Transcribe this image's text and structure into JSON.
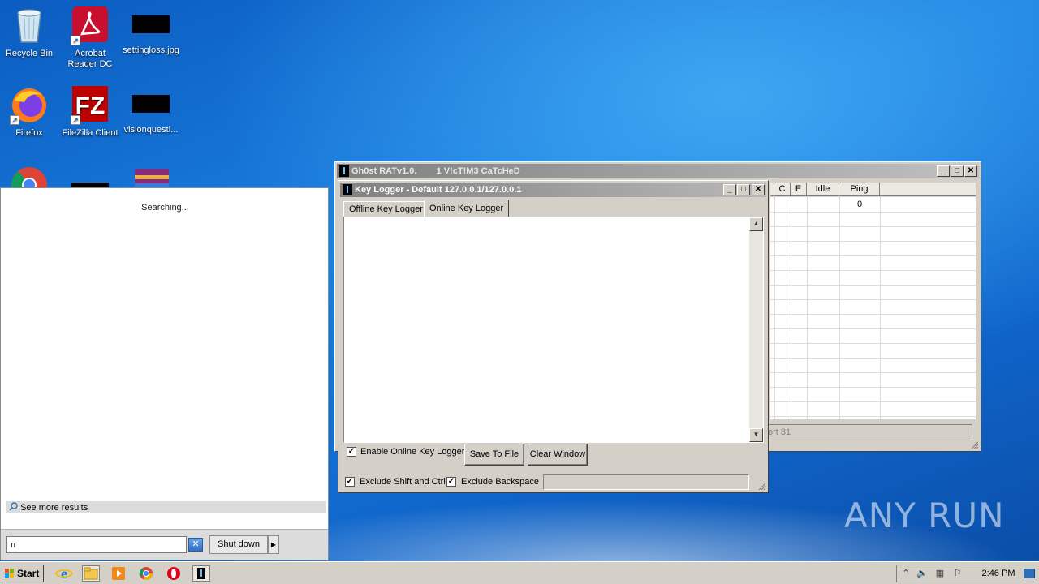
{
  "desktop": {
    "icons": [
      {
        "label": "Recycle Bin"
      },
      {
        "label": "Acrobat Reader DC"
      },
      {
        "label": "settingloss.jpg"
      },
      {
        "label": "Firefox"
      },
      {
        "label": "FileZilla Client"
      },
      {
        "label": "visionquesti..."
      }
    ],
    "watermark": "ANY RUN"
  },
  "start_menu": {
    "status": "Searching...",
    "see_more": "See more results",
    "search_value": "n",
    "shutdown_label": "Shut down"
  },
  "gh0st_window": {
    "title": "Gh0st RATv1.0.",
    "subtitle": "1 V!cT!M3 CaTcHeD",
    "columns": [
      "C",
      "E",
      "Idle",
      "Ping"
    ],
    "ping_value": "0",
    "status_text": "ort 81"
  },
  "keylogger_window": {
    "title": "Key Logger - Default 127.0.0.1/127.0.0.1",
    "tabs": [
      "Offline Key Logger",
      "Online Key Logger"
    ],
    "active_tab": "Online Key Logger",
    "log_text": "",
    "enable_online_label": "Enable Online Key Logger",
    "enable_online_checked": true,
    "save_button": "Save To File",
    "clear_button": "Clear Window",
    "exclude_shift_label": "Exclude Shift and Ctrl",
    "exclude_shift_checked": true,
    "exclude_backspace_label": "Exclude Backspace",
    "exclude_backspace_checked": true
  },
  "taskbar": {
    "start_label": "Start",
    "clock": "2:46 PM"
  }
}
